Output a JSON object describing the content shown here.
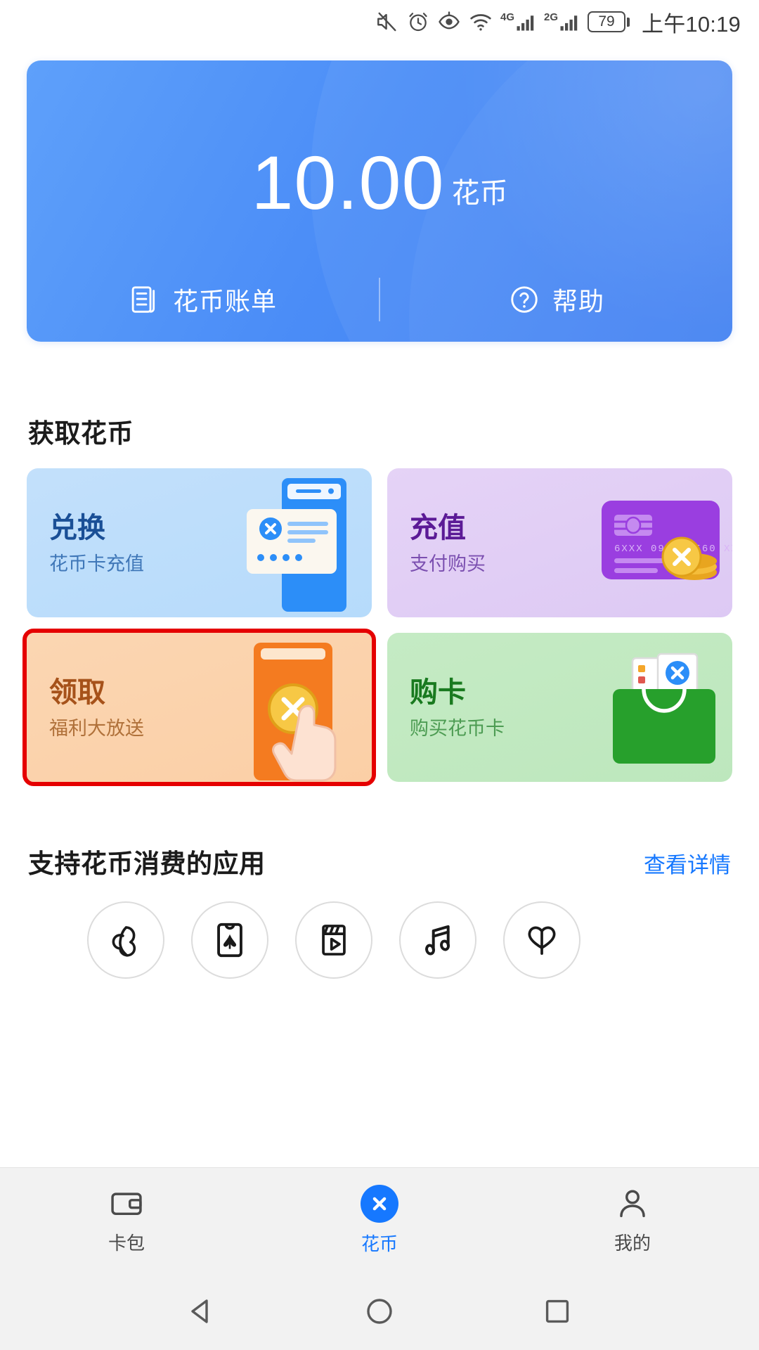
{
  "status_bar": {
    "icons": [
      "mute-icon",
      "alarm-icon",
      "eye-comfort-icon",
      "wifi-icon",
      "signal-4g-icon",
      "signal-2g-icon"
    ],
    "network_1": "4G",
    "network_2": "2G",
    "battery_percent": "79",
    "time": "上午10:19"
  },
  "balance_card": {
    "amount": "10.00",
    "unit": "花币",
    "actions": [
      {
        "label": "花币账单",
        "icon": "bill-list-icon"
      },
      {
        "label": "帮助",
        "icon": "question-circle-icon"
      }
    ],
    "accent": "#4b8df7"
  },
  "get_coins": {
    "title": "获取花币",
    "cards": [
      {
        "title": "兑换",
        "sub": "花币卡充值",
        "theme": "theme-blue",
        "art": "phone-card-icon",
        "selected": false
      },
      {
        "title": "充值",
        "sub": "支付购买",
        "theme": "theme-purple",
        "art": "credit-card-coins-icon",
        "selected": false
      },
      {
        "title": "领取",
        "sub": "福利大放送",
        "theme": "theme-orange",
        "art": "tap-coin-icon",
        "selected": true
      },
      {
        "title": "购卡",
        "sub": "购买花币卡",
        "theme": "theme-green",
        "art": "shopping-bag-icon",
        "selected": false
      }
    ],
    "selection_color": "#e50000"
  },
  "supported_apps": {
    "title": "支持花币消费的应用",
    "link": "查看详情",
    "link_color": "#1678ff",
    "apps": [
      {
        "icon": "cloud-icon"
      },
      {
        "icon": "huawei-themes-icon"
      },
      {
        "icon": "video-icon"
      },
      {
        "icon": "music-icon"
      },
      {
        "icon": "reader-icon"
      }
    ]
  },
  "bottom_nav": {
    "items": [
      {
        "label": "卡包",
        "icon": "wallet-icon",
        "active": false
      },
      {
        "label": "花币",
        "icon": "coin-icon",
        "active": true
      },
      {
        "label": "我的",
        "icon": "person-icon",
        "active": false
      }
    ],
    "active_color": "#1678ff"
  },
  "system_nav": {
    "buttons": [
      "back-button",
      "home-button",
      "recents-button"
    ]
  }
}
